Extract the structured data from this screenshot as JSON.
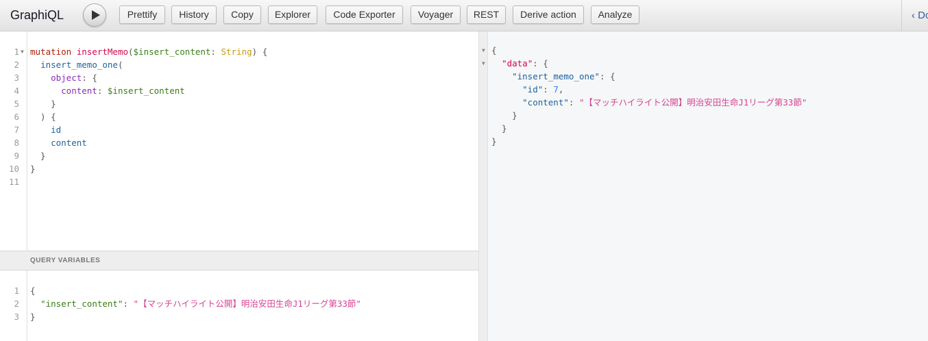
{
  "toolbar": {
    "title": "GraphiQL",
    "run_label": "Execute query",
    "buttons": [
      "Prettify",
      "History",
      "Copy",
      "Explorer",
      "Code Exporter",
      "Voyager",
      "REST",
      "Derive action",
      "Analyze"
    ],
    "docs_label": "Docs"
  },
  "query": {
    "lines": [
      [
        [
          "kw",
          "mutation "
        ],
        [
          "def",
          "insertMemo"
        ],
        [
          "p",
          "("
        ],
        [
          "var",
          "$insert_content"
        ],
        [
          "p",
          ": "
        ],
        [
          "ty",
          "String"
        ],
        [
          "p",
          ") {"
        ]
      ],
      [
        [
          "p",
          "  "
        ],
        [
          "prop",
          "insert_memo_one"
        ],
        [
          "p",
          "("
        ]
      ],
      [
        [
          "p",
          "    "
        ],
        [
          "attr",
          "object"
        ],
        [
          "p",
          ": {"
        ]
      ],
      [
        [
          "p",
          "      "
        ],
        [
          "attr",
          "content"
        ],
        [
          "p",
          ": "
        ],
        [
          "var",
          "$insert_content"
        ]
      ],
      [
        [
          "p",
          "    }"
        ]
      ],
      [
        [
          "p",
          "  ) {"
        ]
      ],
      [
        [
          "p",
          "    "
        ],
        [
          "prop",
          "id"
        ]
      ],
      [
        [
          "p",
          "    "
        ],
        [
          "prop",
          "content"
        ]
      ],
      [
        [
          "p",
          "  }"
        ]
      ],
      [
        [
          "p",
          "}"
        ]
      ],
      [
        [
          "p",
          ""
        ]
      ]
    ]
  },
  "variables": {
    "header": "QUERY VARIABLES",
    "lines": [
      [
        [
          "p",
          "{"
        ]
      ],
      [
        [
          "p",
          "  "
        ],
        [
          "vk",
          "\"insert_content\""
        ],
        [
          "p",
          ": "
        ],
        [
          "str",
          "\"【マッチハイライト公開】明治安田生命J1リーグ第33節\""
        ]
      ],
      [
        [
          "p",
          "}"
        ]
      ]
    ]
  },
  "result": {
    "lines": [
      [
        [
          "p",
          "{"
        ]
      ],
      [
        [
          "p",
          "  "
        ],
        [
          "def",
          "\"data\""
        ],
        [
          "p",
          ": {"
        ]
      ],
      [
        [
          "p",
          "    "
        ],
        [
          "prop",
          "\"insert_memo_one\""
        ],
        [
          "p",
          ": {"
        ]
      ],
      [
        [
          "p",
          "      "
        ],
        [
          "prop",
          "\"id\""
        ],
        [
          "p",
          ": "
        ],
        [
          "num",
          "7"
        ],
        [
          "p",
          ","
        ]
      ],
      [
        [
          "p",
          "      "
        ],
        [
          "prop",
          "\"content\""
        ],
        [
          "p",
          ": "
        ],
        [
          "str",
          "\"【マッチハイライト公開】明治安田生命J1リーグ第33節\""
        ]
      ],
      [
        [
          "p",
          "    }"
        ]
      ],
      [
        [
          "p",
          "  }"
        ]
      ],
      [
        [
          "p",
          "}"
        ]
      ]
    ]
  }
}
